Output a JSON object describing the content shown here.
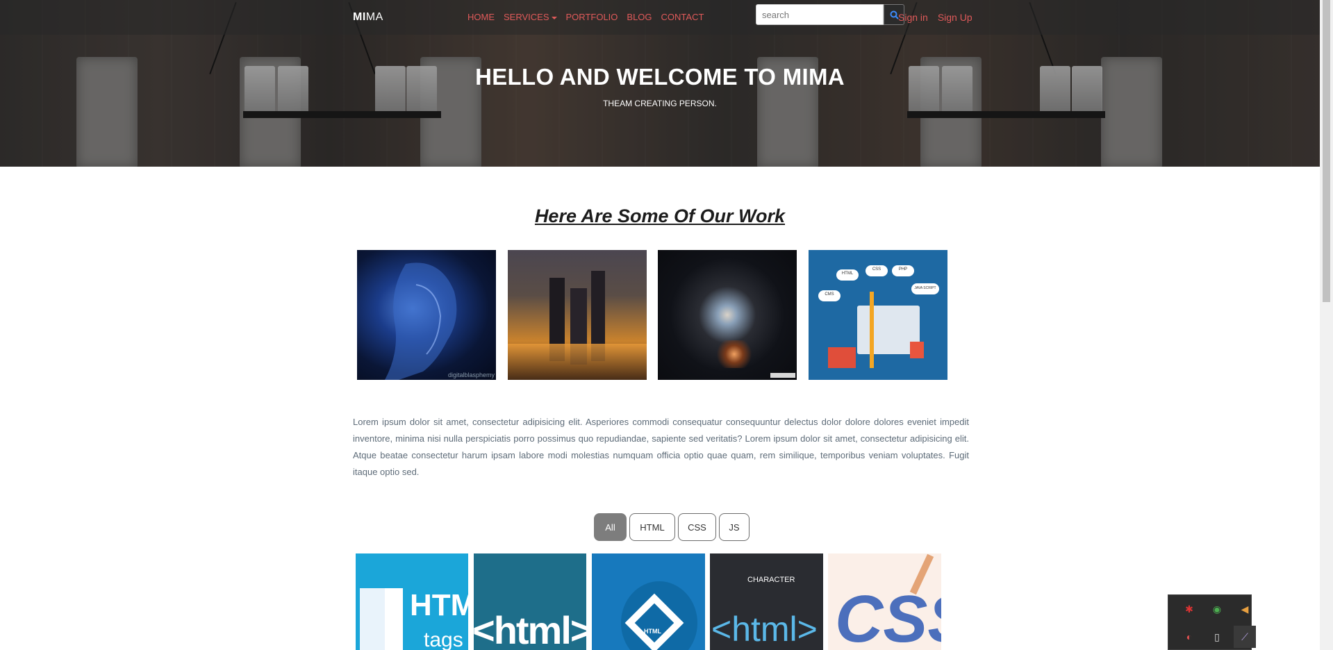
{
  "nav": {
    "brand_bold": "MI",
    "brand_rest": "MA",
    "links": [
      "HOME",
      "SERVICES",
      "PORTFOLIO",
      "BLOG",
      "CONTACT"
    ],
    "search_placeholder": "search",
    "sign_in": "Sign in",
    "sign_up": "Sign Up"
  },
  "hero": {
    "title": "HELLO AND WELCOME TO MIMA",
    "subtitle": "THEAM CREATING PERSON."
  },
  "work": {
    "title": "Here Are Some Of Our Work",
    "image_watermark": "digitalblasphemy",
    "infographic_labels": [
      "HTML",
      "CSS",
      "PHP",
      "JAVA SCRIPT",
      "CMS"
    ]
  },
  "about": {
    "text": "Lorem ipsum dolor sit amet, consectetur adipisicing elit. Asperiores commodi consequatur consequuntur delectus dolor dolore dolores eveniet impedit inventore, minima nisi nulla perspiciatis porro possimus quo repudiandae, sapiente sed veritatis? Lorem ipsum dolor sit amet, consectetur adipisicing elit. Atque beatae consectetur harum ipsam labore modi molestias numquam officia optio quae quam, rem similique, temporibus veniam voluptates. Fugit itaque optio sed."
  },
  "filters": {
    "items": [
      "All",
      "HTML",
      "CSS",
      "JS"
    ],
    "active": "All"
  },
  "thumbs": {
    "t1_text": "HTML",
    "t1_sub": "tags",
    "t2_text": "<html>",
    "t3_text": "HTML",
    "t4_label": "CHARACTER",
    "t4_text": "<html>",
    "t5_text": "CSS"
  },
  "colors": {
    "nav_link": "#e05a5a",
    "search_button": "#2b2b2b",
    "filter_active": "#7d7d7d"
  }
}
